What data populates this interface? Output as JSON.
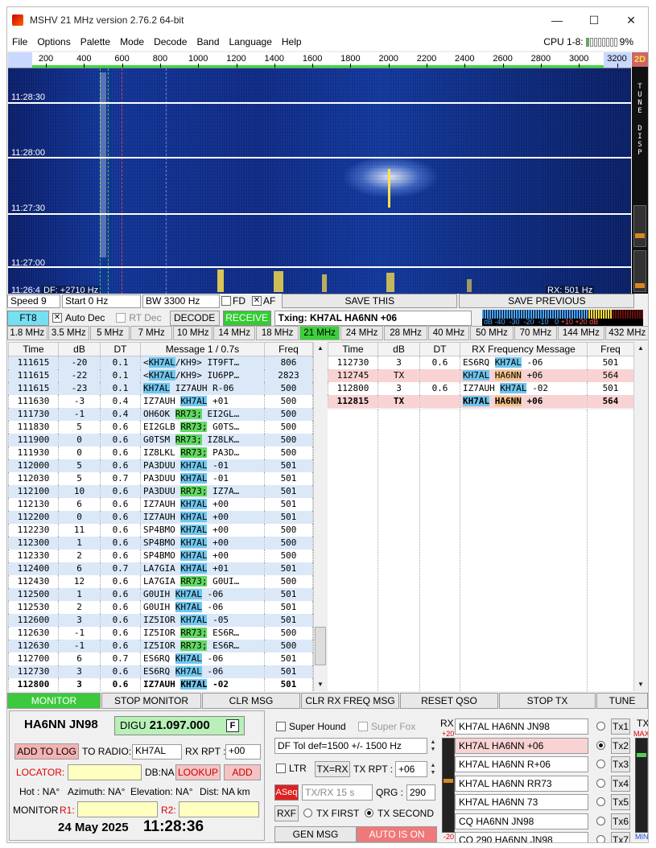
{
  "window": {
    "title": "MSHV 21 MHz version 2.76.2 64-bit",
    "minimize_glyph": "—",
    "maximize_glyph": "☐",
    "close_glyph": "✕"
  },
  "menu": [
    "File",
    "Options",
    "Palette",
    "Mode",
    "Decode",
    "Band",
    "Language",
    "Help"
  ],
  "cpu": {
    "label": "CPU 1-8:",
    "value": "9%",
    "bars_on": 1,
    "bars_total": 8
  },
  "ruler": {
    "ticks": [
      "200",
      "400",
      "600",
      "800",
      "1000",
      "1200",
      "1400",
      "1600",
      "1800",
      "2000",
      "2200",
      "2400",
      "2600",
      "2800",
      "3000",
      "3200"
    ]
  },
  "waterfall": {
    "times": [
      "11:28:30",
      "11:28:00",
      "11:27:30",
      "11:27:00",
      "11:26:4"
    ],
    "df_label": "DF: +2710 Hz",
    "rx_label": "RX: 501 Hz"
  },
  "side": {
    "mode2d": "2D",
    "tune": [
      "T",
      "U",
      "N",
      "E"
    ],
    "disp": [
      "D",
      "I",
      "S",
      "P"
    ]
  },
  "controls": {
    "speed": "Speed 9",
    "start": "Start 0 Hz",
    "bw": "BW 3300 Hz",
    "fd_label": "FD",
    "af_label": "AF",
    "save_this": "SAVE THIS",
    "save_previous": "SAVE PREVIOUS"
  },
  "moderow": {
    "mode": "FT8",
    "auto_dec": "Auto Dec",
    "rt_dec": "RT Dec",
    "decode": "DECODE",
    "receive": "RECEIVE",
    "txing": "Txing: KH7AL HA6NN +06",
    "meter_db": "dB",
    "meter_blue": "-40  -30  -20  -10   0",
    "meter_red": "+10 +20 dB"
  },
  "bands": [
    {
      "label": "1.8 MHz",
      "sel": false
    },
    {
      "label": "3.5 MHz",
      "sel": false
    },
    {
      "label": "5 MHz",
      "sel": false
    },
    {
      "label": "7 MHz",
      "sel": false
    },
    {
      "label": "10 MHz",
      "sel": false
    },
    {
      "label": "14 MHz",
      "sel": false
    },
    {
      "label": "18 MHz",
      "sel": false
    },
    {
      "label": "21 MHz",
      "sel": true
    },
    {
      "label": "24 MHz",
      "sel": false
    },
    {
      "label": "28 MHz",
      "sel": false
    },
    {
      "label": "40 MHz",
      "sel": false
    },
    {
      "label": "50 MHz",
      "sel": false
    },
    {
      "label": "70 MHz",
      "sel": false
    },
    {
      "label": "144 MHz",
      "sel": false
    },
    {
      "label": "432 MHz",
      "sel": false
    }
  ],
  "left_table": {
    "headers": [
      "Time",
      "dB",
      "DT",
      "Message 1 / 0.7s",
      "Freq"
    ],
    "rows": [
      {
        "t": "111615",
        "db": "-20",
        "dt": "0.1",
        "m": [
          [
            "<",
            ""
          ],
          [
            "KH7AL",
            "b"
          ],
          [
            "/KH9> IT9FT…",
            ""
          ]
        ],
        "f": "806",
        "alt": true
      },
      {
        "t": "111615",
        "db": "-22",
        "dt": "0.1",
        "m": [
          [
            "<",
            ""
          ],
          [
            "KH7AL",
            "b"
          ],
          [
            "/KH9> IU6PP…",
            ""
          ]
        ],
        "f": "2823",
        "alt": true
      },
      {
        "t": "111615",
        "db": "-23",
        "dt": "0.1",
        "m": [
          [
            "KH7AL",
            "b"
          ],
          [
            " IZ7AUH R-06",
            ""
          ]
        ],
        "f": "500",
        "alt": true
      },
      {
        "t": "111630",
        "db": "-3",
        "dt": "0.4",
        "m": [
          [
            "IZ7AUH ",
            ""
          ],
          [
            "KH7AL",
            "b"
          ],
          [
            " +01",
            ""
          ]
        ],
        "f": "500",
        "alt": false
      },
      {
        "t": "111730",
        "db": "-1",
        "dt": "0.4",
        "m": [
          [
            "OH6OK ",
            ""
          ],
          [
            "RR73;",
            "g"
          ],
          [
            " EI2GL…",
            ""
          ]
        ],
        "f": "500",
        "alt": true
      },
      {
        "t": "111830",
        "db": "5",
        "dt": "0.6",
        "m": [
          [
            "EI2GLB ",
            ""
          ],
          [
            "RR73;",
            "g"
          ],
          [
            " G0TS…",
            ""
          ]
        ],
        "f": "500",
        "alt": false
      },
      {
        "t": "111900",
        "db": "0",
        "dt": "0.6",
        "m": [
          [
            "G0TSM ",
            ""
          ],
          [
            "RR73;",
            "g"
          ],
          [
            " IZ8LK…",
            ""
          ]
        ],
        "f": "500",
        "alt": true
      },
      {
        "t": "111930",
        "db": "0",
        "dt": "0.6",
        "m": [
          [
            "IZ8LKL ",
            ""
          ],
          [
            "RR73;",
            "g"
          ],
          [
            " PA3D…",
            ""
          ]
        ],
        "f": "500",
        "alt": false
      },
      {
        "t": "112000",
        "db": "5",
        "dt": "0.6",
        "m": [
          [
            "PA3DUU ",
            ""
          ],
          [
            "KH7AL",
            "b"
          ],
          [
            " -01",
            ""
          ]
        ],
        "f": "501",
        "alt": true
      },
      {
        "t": "112030",
        "db": "5",
        "dt": "0.7",
        "m": [
          [
            "PA3DUU ",
            ""
          ],
          [
            "KH7AL",
            "b"
          ],
          [
            " -01",
            ""
          ]
        ],
        "f": "501",
        "alt": false
      },
      {
        "t": "112100",
        "db": "10",
        "dt": "0.6",
        "m": [
          [
            "PA3DUU ",
            ""
          ],
          [
            "RR73;",
            "g"
          ],
          [
            " IZ7A…",
            ""
          ]
        ],
        "f": "501",
        "alt": true
      },
      {
        "t": "112130",
        "db": "6",
        "dt": "0.6",
        "m": [
          [
            "IZ7AUH ",
            ""
          ],
          [
            "KH7AL",
            "b"
          ],
          [
            " +00",
            ""
          ]
        ],
        "f": "501",
        "alt": false
      },
      {
        "t": "112200",
        "db": "0",
        "dt": "0.6",
        "m": [
          [
            "IZ7AUH ",
            ""
          ],
          [
            "KH7AL",
            "b"
          ],
          [
            " +00",
            ""
          ]
        ],
        "f": "501",
        "alt": true
      },
      {
        "t": "112230",
        "db": "11",
        "dt": "0.6",
        "m": [
          [
            "SP4BMO ",
            ""
          ],
          [
            "KH7AL",
            "b"
          ],
          [
            " +00",
            ""
          ]
        ],
        "f": "500",
        "alt": false
      },
      {
        "t": "112300",
        "db": "1",
        "dt": "0.6",
        "m": [
          [
            "SP4BMO ",
            ""
          ],
          [
            "KH7AL",
            "b"
          ],
          [
            " +00",
            ""
          ]
        ],
        "f": "500",
        "alt": true
      },
      {
        "t": "112330",
        "db": "2",
        "dt": "0.6",
        "m": [
          [
            "SP4BMO ",
            ""
          ],
          [
            "KH7AL",
            "b"
          ],
          [
            " +00",
            ""
          ]
        ],
        "f": "500",
        "alt": false
      },
      {
        "t": "112400",
        "db": "6",
        "dt": "0.7",
        "m": [
          [
            "LA7GIA ",
            ""
          ],
          [
            "KH7AL",
            "b"
          ],
          [
            " +01",
            ""
          ]
        ],
        "f": "501",
        "alt": true
      },
      {
        "t": "112430",
        "db": "12",
        "dt": "0.6",
        "m": [
          [
            "LA7GIA ",
            ""
          ],
          [
            "RR73;",
            "g"
          ],
          [
            " G0UI…",
            ""
          ]
        ],
        "f": "500",
        "alt": false
      },
      {
        "t": "112500",
        "db": "1",
        "dt": "0.6",
        "m": [
          [
            "G0UIH ",
            ""
          ],
          [
            "KH7AL",
            "b"
          ],
          [
            " -06",
            ""
          ]
        ],
        "f": "501",
        "alt": true
      },
      {
        "t": "112530",
        "db": "2",
        "dt": "0.6",
        "m": [
          [
            "G0UIH ",
            ""
          ],
          [
            "KH7AL",
            "b"
          ],
          [
            " -06",
            ""
          ]
        ],
        "f": "501",
        "alt": false
      },
      {
        "t": "112600",
        "db": "3",
        "dt": "0.6",
        "m": [
          [
            "IZ5IOR ",
            ""
          ],
          [
            "KH7AL",
            "b"
          ],
          [
            " -05",
            ""
          ]
        ],
        "f": "501",
        "alt": true
      },
      {
        "t": "112630",
        "db": "-1",
        "dt": "0.6",
        "m": [
          [
            "IZ5IOR ",
            ""
          ],
          [
            "RR73;",
            "g"
          ],
          [
            " ES6R…",
            ""
          ]
        ],
        "f": "500",
        "alt": false
      },
      {
        "t": "112630",
        "db": "-1",
        "dt": "0.6",
        "m": [
          [
            "IZ5IOR ",
            ""
          ],
          [
            "RR73;",
            "g"
          ],
          [
            " ES6R…",
            ""
          ]
        ],
        "f": "500",
        "alt": true
      },
      {
        "t": "112700",
        "db": "6",
        "dt": "0.7",
        "m": [
          [
            "ES6RQ ",
            ""
          ],
          [
            "KH7AL",
            "b"
          ],
          [
            " -06",
            ""
          ]
        ],
        "f": "501",
        "alt": false
      },
      {
        "t": "112730",
        "db": "3",
        "dt": "0.6",
        "m": [
          [
            "ES6RQ ",
            ""
          ],
          [
            "KH7AL",
            "b"
          ],
          [
            " -06",
            ""
          ]
        ],
        "f": "501",
        "alt": true
      },
      {
        "t": "112800",
        "db": "3",
        "dt": "0.6",
        "m": [
          [
            "IZ7AUH ",
            ""
          ],
          [
            "KH7AL",
            "b"
          ],
          [
            " -02",
            ""
          ]
        ],
        "f": "501",
        "alt": false,
        "bold": true
      }
    ]
  },
  "right_table": {
    "headers": [
      "Time",
      "dB",
      "DT",
      "RX Frequency Message",
      "Freq"
    ],
    "rows": [
      {
        "t": "112730",
        "db": "3",
        "dt": "0.6",
        "m": [
          [
            "ES6RQ ",
            ""
          ],
          [
            "KH7AL",
            "b"
          ],
          [
            " -06",
            ""
          ]
        ],
        "f": "501",
        "tx": false
      },
      {
        "t": "112745",
        "db": "TX",
        "dt": "",
        "m": [
          [
            "KH7AL",
            "b"
          ],
          [
            " ",
            ""
          ],
          [
            "HA6NN",
            "o"
          ],
          [
            " +06",
            ""
          ]
        ],
        "f": "564",
        "tx": true
      },
      {
        "t": "112800",
        "db": "3",
        "dt": "0.6",
        "m": [
          [
            "IZ7AUH ",
            ""
          ],
          [
            "KH7AL",
            "b"
          ],
          [
            " -02",
            ""
          ]
        ],
        "f": "501",
        "tx": false
      },
      {
        "t": "112815",
        "db": "TX",
        "dt": "",
        "m": [
          [
            "KH7AL",
            "b"
          ],
          [
            " ",
            ""
          ],
          [
            "HA6NN",
            "o"
          ],
          [
            " +06",
            ""
          ]
        ],
        "f": "564",
        "tx": true,
        "bold": true
      }
    ]
  },
  "bigbuttons": [
    "MONITOR",
    "STOP MONITOR",
    "CLR MSG",
    "CLR RX FREQ MSG",
    "RESET QSO",
    "STOP TX",
    "TUNE"
  ],
  "station": {
    "call": "HA6NN JN98",
    "mode": "DIGU",
    "freq": "21.097.000",
    "f_btn": "F",
    "add_to_log": "ADD TO LOG",
    "to_radio_label": "TO RADIO:",
    "to_radio": "KH7AL",
    "rx_rpt_label": "RX RPT :",
    "rx_rpt": "+00",
    "locator_label": "LOCATOR:",
    "db_na": "DB:NA",
    "lookup": "LOOKUP",
    "add": "ADD",
    "hot": "Hot : NA°",
    "azimuth": "Azimuth: NA°",
    "elevation": "Elevation: NA°",
    "dist": "Dist: NA km",
    "monitor_label": "MONITOR",
    "r1": "R1:",
    "r2": "R2:",
    "date": "24 May 2025",
    "time": "11:28:36"
  },
  "mid": {
    "super_hound": "Super Hound",
    "super_fox": "Super Fox",
    "df_tol": "DF Tol def=1500 +/-  1500  Hz",
    "ltr": "LTR",
    "tx_eq_rx": "TX=RX",
    "tx_rpt_label": "TX RPT :",
    "tx_rpt": "+06",
    "aseq": "ASeq",
    "txrx15": "TX/RX 15  s",
    "qrg_label": "QRG :",
    "qrg": "290",
    "rxf": "RXF",
    "tx_first": "TX FIRST",
    "tx_second": "TX SECOND",
    "gen_msg": "GEN MSG",
    "auto_is_on": "AUTO IS ON"
  },
  "tx": {
    "rx_label": "RX",
    "rx_plus": "+20",
    "rx_minus": "-20",
    "tx_label": "TX",
    "tx_max": "MAX",
    "tx_min": "MIN",
    "lines": [
      {
        "msg": "KH7AL HA6NN JN98",
        "btn": "Tx1",
        "sel": false
      },
      {
        "msg": "KH7AL HA6NN +06",
        "btn": "Tx2",
        "sel": true
      },
      {
        "msg": "KH7AL HA6NN R+06",
        "btn": "Tx3",
        "sel": false
      },
      {
        "msg": "KH7AL HA6NN RR73",
        "btn": "Tx4",
        "sel": false
      },
      {
        "msg": "KH7AL HA6NN 73",
        "btn": "Tx5",
        "sel": false
      },
      {
        "msg": "CQ HA6NN JN98",
        "btn": "Tx6",
        "sel": false
      },
      {
        "msg": "CQ 290 HA6NN JN98",
        "btn": "Tx7",
        "sel": false
      }
    ]
  }
}
